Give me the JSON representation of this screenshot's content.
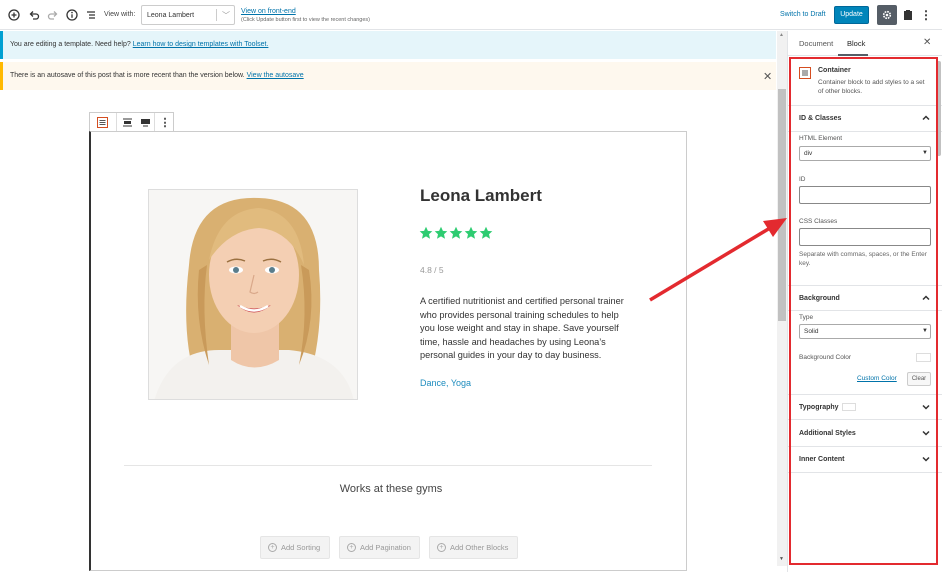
{
  "topbar": {
    "view_with_label": "View with:",
    "view_with_value": "Leona Lambert",
    "frontend_link": "View on front-end",
    "frontend_note": "(Click Update button first to view the recent changes)",
    "switch_draft": "Switch to Draft",
    "update": "Update"
  },
  "notices": {
    "info_text": "You are editing a template. Need help? ",
    "info_link": "Learn how to design templates with Toolset.",
    "autosave_text": "There is an autosave of this post that is more recent than the version below. ",
    "autosave_link": "View the autosave"
  },
  "profile": {
    "name": "Leona Lambert",
    "stars": 5,
    "rating": "4.8 / 5",
    "bio": "A certified nutritionist and certified personal trainer who provides personal training schedules to help you lose weight and stay in shape. Save yourself time, hassle and headaches by using Leona’s personal guides in your day to day business.",
    "tags": "Dance, Yoga",
    "star_color": "#2ecc71"
  },
  "gyms": {
    "title": "Works at these gyms",
    "buttons": [
      "Add Sorting",
      "Add Pagination",
      "Add Other Blocks"
    ]
  },
  "sidebar": {
    "tabs": [
      "Document",
      "Block"
    ],
    "active_tab": "Block",
    "block": {
      "title": "Container",
      "description": "Container block to add styles to a set of other blocks."
    },
    "id_classes": {
      "heading": "ID & Classes",
      "html_element_label": "HTML Element",
      "html_element_value": "div",
      "id_label": "ID",
      "id_value": "",
      "css_label": "CSS Classes",
      "css_value": "",
      "css_help": "Separate with commas, spaces, or the Enter key."
    },
    "background": {
      "heading": "Background",
      "type_label": "Type",
      "type_value": "Solid",
      "color_label": "Background Color",
      "custom_color": "Custom Color",
      "clear": "Clear"
    },
    "collapsed_panels": [
      "Typography",
      "Additional Styles",
      "Inner Content"
    ]
  },
  "colors": {
    "accent": "#0085ba",
    "highlight": "#e32a2f",
    "link": "#0073aa"
  }
}
